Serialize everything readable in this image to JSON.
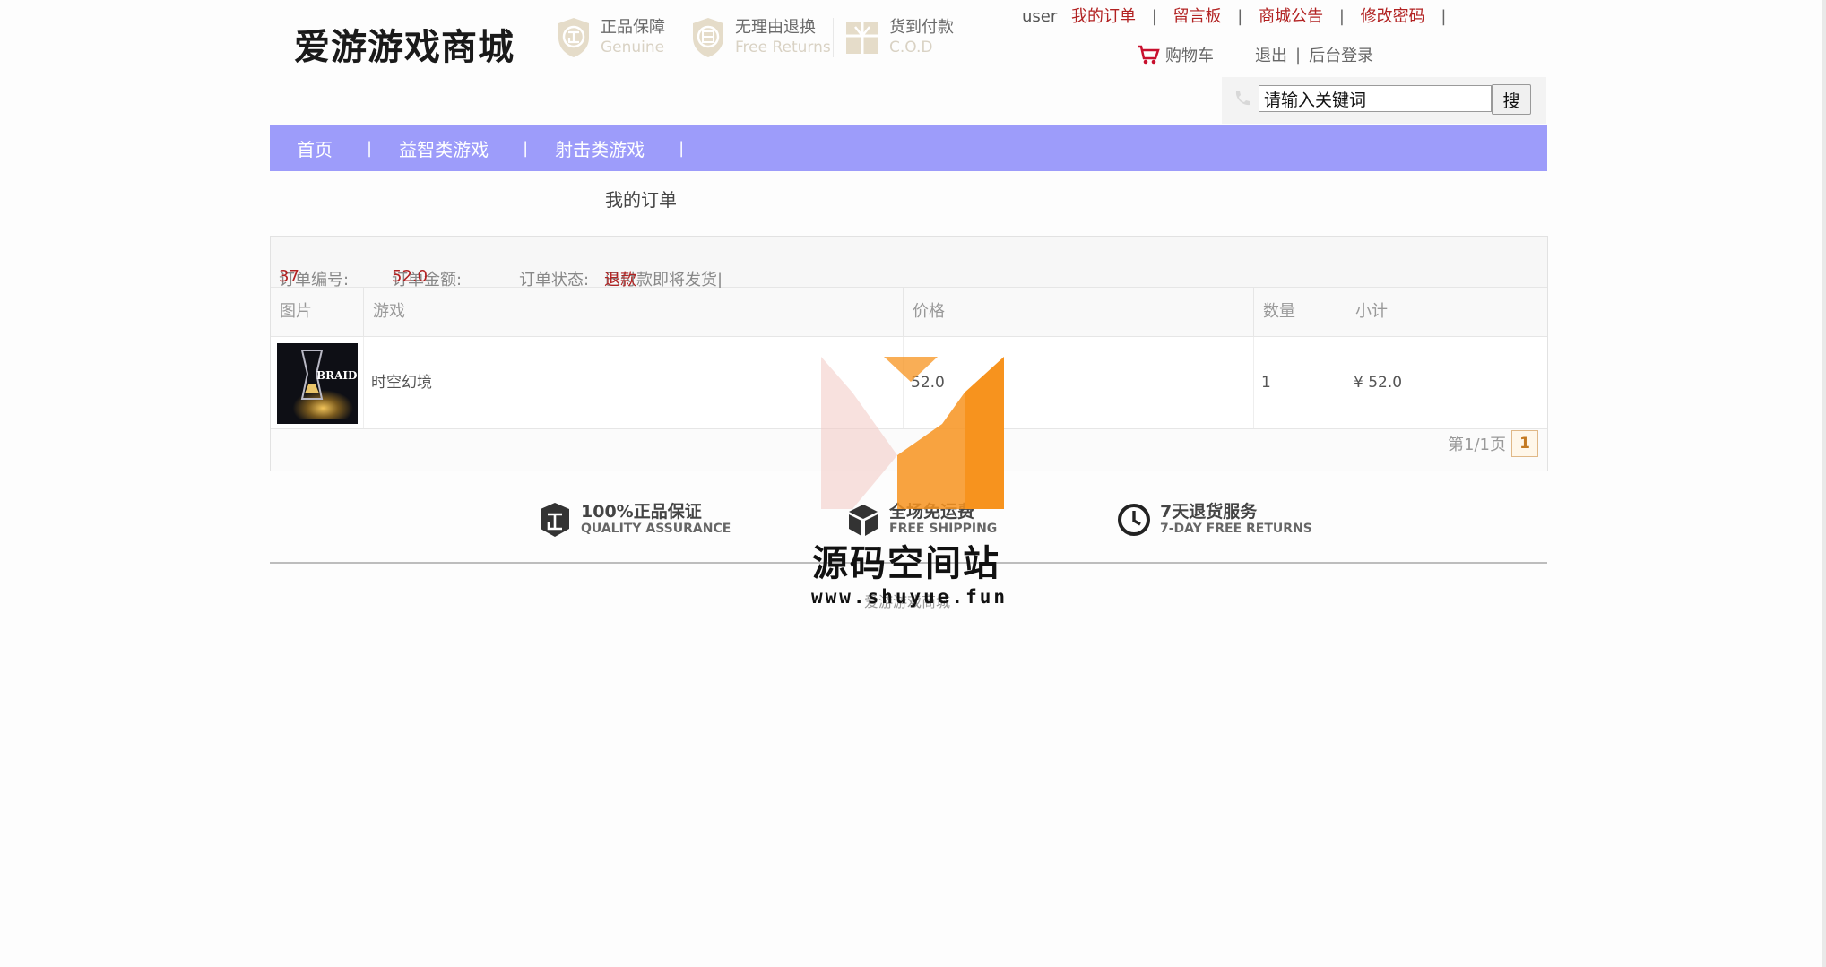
{
  "header": {
    "logo": "爱游游戏商城",
    "badges": [
      {
        "cn": "正品保障",
        "en": "Genuine",
        "icon": "shield-zheng-icon"
      },
      {
        "cn": "无理由退换",
        "en": "Free Returns",
        "icon": "shield-tui-icon"
      },
      {
        "cn": "货到付款",
        "en": "C.O.D",
        "icon": "gift-box-icon"
      }
    ],
    "username": "user",
    "links": [
      "我的订单",
      "留言板",
      "商城公告",
      "修改密码"
    ],
    "pipe": "|",
    "cart_label": "购物车",
    "logout": "退出",
    "admin_login": "后台登录"
  },
  "search": {
    "placeholder": "请输入关键词",
    "value": "请输入关键词",
    "button_label": "搜"
  },
  "nav": {
    "items": [
      "首页",
      "益智类游戏",
      "射击类游戏"
    ],
    "sep": "|",
    "bg_color": "#9d9cfa"
  },
  "page": {
    "title": "我的订单"
  },
  "order": {
    "id_label": "订单编号:",
    "id": "37",
    "amount_label": "订单金额:",
    "amount": "52.0",
    "status_label": "订单状态:",
    "status": "已付款即将发货|",
    "refund_label": "退款",
    "columns": [
      "图片",
      "游戏",
      "价格",
      "数量",
      "小计"
    ],
    "items": [
      {
        "game": "时空幻境",
        "price": "52.0",
        "qty": "1",
        "subtotal": "¥ 52.0",
        "thumb_text": "BRAID"
      }
    ],
    "pager_text": "第1/1页",
    "current_page": "1"
  },
  "features": [
    {
      "cn": "100%正品保证",
      "en": "QUALITY ASSURANCE",
      "icon": "zheng-badge-icon"
    },
    {
      "cn": "全场免运费",
      "en": "FREE SHIPPING",
      "icon": "box-icon"
    },
    {
      "cn": "7天退货服务",
      "en": "7-DAY FREE RETURNS",
      "icon": "clock-icon"
    }
  ],
  "footer": {
    "copyright": "爱游游戏商城"
  },
  "watermark": {
    "cn": "源码空间站",
    "url": "www.shuyue.fun",
    "colors": {
      "orange": "#f7931e",
      "light": "#f2c9c3"
    }
  }
}
